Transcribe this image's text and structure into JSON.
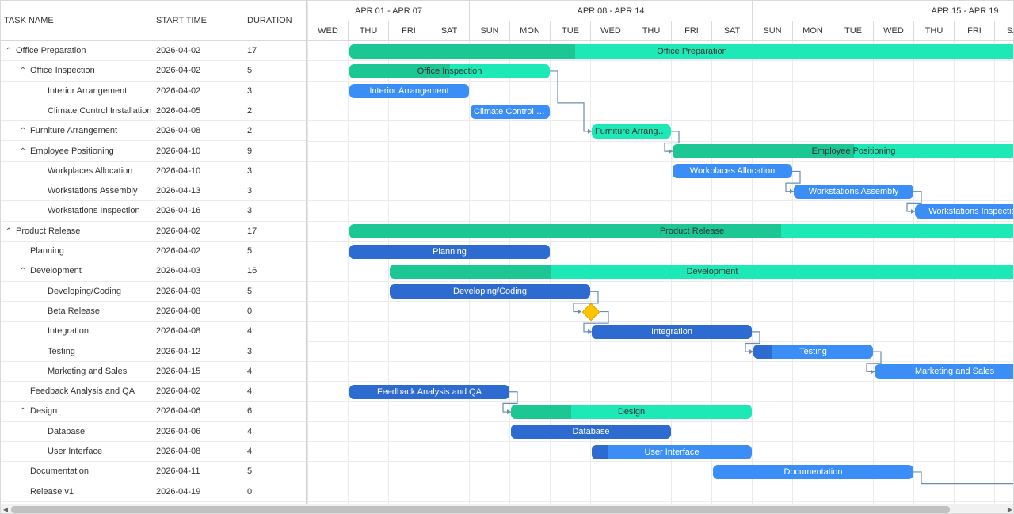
{
  "grid": {
    "columns": {
      "task_name": "TASK NAME",
      "start_time": "START TIME",
      "duration": "DURATION"
    },
    "tasks": [
      {
        "id": 1,
        "name": "Office Preparation",
        "start": "2026-04-02",
        "duration": "17",
        "level": 0,
        "expanded": true,
        "has_children": true,
        "type": "project",
        "progress": 0.33,
        "parent": 0
      },
      {
        "id": 2,
        "name": "Office Inspection",
        "start": "2026-04-02",
        "duration": "5",
        "level": 1,
        "expanded": true,
        "has_children": true,
        "type": "project",
        "progress": 0.5,
        "parent": 1
      },
      {
        "id": 3,
        "name": "Interior Arrangement",
        "start": "2026-04-02",
        "duration": "3",
        "level": 2,
        "expanded": false,
        "has_children": false,
        "type": "task",
        "progress": 0,
        "parent": 2
      },
      {
        "id": 4,
        "name": "Climate Control Installation",
        "start": "2026-04-05",
        "duration": "2",
        "level": 2,
        "expanded": false,
        "has_children": false,
        "type": "task",
        "progress": 0,
        "parent": 2
      },
      {
        "id": 5,
        "name": "Furniture Arrangement",
        "start": "2026-04-08",
        "duration": "2",
        "level": 1,
        "expanded": true,
        "has_children": true,
        "type": "project",
        "progress": 0,
        "parent": 1
      },
      {
        "id": 6,
        "name": "Employee Positioning",
        "start": "2026-04-10",
        "duration": "9",
        "level": 1,
        "expanded": true,
        "has_children": true,
        "type": "project",
        "progress": 0.5,
        "parent": 1
      },
      {
        "id": 7,
        "name": "Workplaces Allocation",
        "start": "2026-04-10",
        "duration": "3",
        "level": 2,
        "expanded": false,
        "has_children": false,
        "type": "task",
        "progress": 0,
        "parent": 6
      },
      {
        "id": 8,
        "name": "Workstations Assembly",
        "start": "2026-04-13",
        "duration": "3",
        "level": 2,
        "expanded": false,
        "has_children": false,
        "type": "task",
        "progress": 0,
        "parent": 6
      },
      {
        "id": 9,
        "name": "Workstations Inspection",
        "start": "2026-04-16",
        "duration": "3",
        "level": 2,
        "expanded": false,
        "has_children": false,
        "type": "task",
        "progress": 0,
        "parent": 6
      },
      {
        "id": 10,
        "name": "Product Release",
        "start": "2026-04-02",
        "duration": "17",
        "level": 0,
        "expanded": true,
        "has_children": true,
        "type": "project",
        "progress": 0.63,
        "parent": 0
      },
      {
        "id": 11,
        "name": "Planning",
        "start": "2026-04-02",
        "duration": "5",
        "level": 1,
        "expanded": false,
        "has_children": false,
        "type": "task",
        "progress": 1,
        "parent": 10
      },
      {
        "id": 12,
        "name": "Development",
        "start": "2026-04-03",
        "duration": "16",
        "level": 1,
        "expanded": true,
        "has_children": true,
        "type": "project",
        "progress": 0.25,
        "parent": 10
      },
      {
        "id": 13,
        "name": "Developing/Coding",
        "start": "2026-04-03",
        "duration": "5",
        "level": 2,
        "expanded": false,
        "has_children": false,
        "type": "task",
        "progress": 1,
        "parent": 12
      },
      {
        "id": 14,
        "name": "Beta Release",
        "start": "2026-04-08",
        "duration": "0",
        "level": 2,
        "expanded": false,
        "has_children": false,
        "type": "milestone",
        "progress": 0,
        "parent": 12
      },
      {
        "id": 15,
        "name": "Integration",
        "start": "2026-04-08",
        "duration": "4",
        "level": 2,
        "expanded": false,
        "has_children": false,
        "type": "task",
        "progress": 1,
        "parent": 12
      },
      {
        "id": 16,
        "name": "Testing",
        "start": "2026-04-12",
        "duration": "3",
        "level": 2,
        "expanded": false,
        "has_children": false,
        "type": "task",
        "progress": 0.15,
        "parent": 12
      },
      {
        "id": 17,
        "name": "Marketing and Sales",
        "start": "2026-04-15",
        "duration": "4",
        "level": 2,
        "expanded": false,
        "has_children": false,
        "type": "task",
        "progress": 0,
        "parent": 12
      },
      {
        "id": 18,
        "name": "Feedback Analysis and QA",
        "start": "2026-04-02",
        "duration": "4",
        "level": 1,
        "expanded": false,
        "has_children": false,
        "type": "task",
        "progress": 1,
        "parent": 10
      },
      {
        "id": 19,
        "name": "Design",
        "start": "2026-04-06",
        "duration": "6",
        "level": 1,
        "expanded": true,
        "has_children": true,
        "type": "project",
        "progress": 0.25,
        "parent": 10
      },
      {
        "id": 20,
        "name": "Database",
        "start": "2026-04-06",
        "duration": "4",
        "level": 2,
        "expanded": false,
        "has_children": false,
        "type": "task",
        "progress": 1,
        "parent": 19
      },
      {
        "id": 21,
        "name": "User Interface",
        "start": "2026-04-08",
        "duration": "4",
        "level": 2,
        "expanded": false,
        "has_children": false,
        "type": "task",
        "progress": 0.1,
        "parent": 19
      },
      {
        "id": 22,
        "name": "Documentation",
        "start": "2026-04-11",
        "duration": "5",
        "level": 1,
        "expanded": false,
        "has_children": false,
        "type": "task",
        "progress": 0,
        "parent": 10
      },
      {
        "id": 23,
        "name": "Release v1",
        "start": "2026-04-19",
        "duration": "0",
        "level": 1,
        "expanded": false,
        "has_children": false,
        "type": "milestone",
        "progress": 0,
        "parent": 10
      }
    ]
  },
  "timeline": {
    "visible_start": "2026-04-01",
    "weeks": [
      {
        "label": "APR 01 - APR 07",
        "start": "2026-04-01",
        "end": "2026-04-05"
      },
      {
        "label": "APR 08 - APR 14",
        "start": "2026-04-05",
        "end": "2026-04-12"
      },
      {
        "label": "APR 15 - APR 19",
        "start": "2026-04-12",
        "end": "2026-04-19"
      }
    ],
    "days": [
      "WED",
      "THU",
      "FRI",
      "SAT",
      "SUN",
      "MON",
      "TUE",
      "WED",
      "THU",
      "FRI",
      "SAT",
      "SUN",
      "MON",
      "TUE",
      "WED",
      "THU",
      "FRI",
      "SAT"
    ],
    "links": [
      {
        "from": 2,
        "to": 5,
        "type": "finish-to-start"
      },
      {
        "from": 5,
        "to": 6,
        "type": "finish-to-start"
      },
      {
        "from": 7,
        "to": 8,
        "type": "finish-to-start"
      },
      {
        "from": 8,
        "to": 9,
        "type": "finish-to-start"
      },
      {
        "from": 13,
        "to": 14,
        "type": "finish-to-start"
      },
      {
        "from": 14,
        "to": 15,
        "type": "finish-to-start"
      },
      {
        "from": 15,
        "to": 16,
        "type": "finish-to-start"
      },
      {
        "from": 16,
        "to": 17,
        "type": "finish-to-start"
      },
      {
        "from": 18,
        "to": 19,
        "type": "finish-to-start"
      },
      {
        "from": 22,
        "to": 23,
        "type": "finish-to-start"
      }
    ]
  },
  "icons": {
    "expanded": "chevron-up-icon",
    "collapsed": "chevron-down-icon",
    "scroll_left": "arrow-left-icon",
    "scroll_right": "arrow-right-icon"
  },
  "glyphs": {
    "expanded": "⌃",
    "collapsed": "⌄",
    "scroll_left": "◀",
    "scroll_right": "▶"
  },
  "colors": {
    "task": "#3a8ef6",
    "task_progress": "#2d6bd0",
    "project": "#1de9b6",
    "project_progress": "#1cc793",
    "milestone": "#ffc400",
    "link": "#6b8cae",
    "grid_line": "#ebebeb"
  }
}
